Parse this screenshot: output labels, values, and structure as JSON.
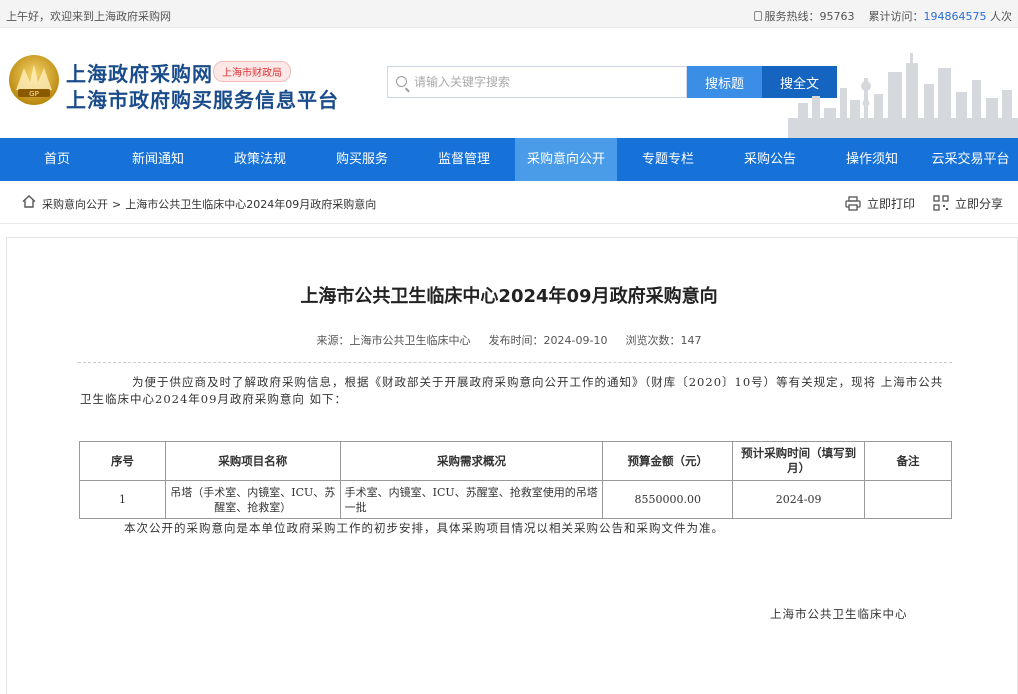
{
  "topbar": {
    "greeting": "上午好，欢迎来到上海政府采购网",
    "hotline_label": "服务热线：",
    "hotline": "95763",
    "visits_label": "累计访问：",
    "visits": "194864575",
    "visits_unit": "人次"
  },
  "header": {
    "site_name": "上海政府采购网",
    "tag": "上海市财政局",
    "subtitle": "上海市政府购买服务信息平台",
    "search_placeholder": "请输入关键字搜索",
    "btn_title": "搜标题",
    "btn_full": "搜全文"
  },
  "nav": [
    {
      "label": "首页"
    },
    {
      "label": "新闻通知"
    },
    {
      "label": "政策法规"
    },
    {
      "label": "购买服务"
    },
    {
      "label": "监督管理"
    },
    {
      "label": "采购意向公开"
    },
    {
      "label": "专题专栏"
    },
    {
      "label": "采购公告"
    },
    {
      "label": "操作须知"
    },
    {
      "label": "云采交易平台"
    }
  ],
  "breadcrumb": {
    "parent": "采购意向公开",
    "sep": ">",
    "current": "上海市公共卫生临床中心2024年09月政府采购意向"
  },
  "actions": {
    "print": "立即打印",
    "share": "立即分享"
  },
  "article": {
    "title": "上海市公共卫生临床中心2024年09月政府采购意向",
    "source": "来源：上海市公共卫生临床中心",
    "date": "发布时间：2024-09-10",
    "views": "浏览次数：147",
    "intro": "为便于供应商及时了解政府采购信息，根据《财政部关于开展政府采购意向公开工作的通知》（财库〔2020〕10号）等有关规定，现将 上海市公共卫生临床中心2024年09月政府采购意向 如下：",
    "note": "本次公开的采购意向是本单位政府采购工作的初步安排，具体采购项目情况以相关采购公告和采购文件为准。",
    "signature": "上海市公共卫生临床中心"
  },
  "table": {
    "headers": [
      "序号",
      "采购项目名称",
      "采购需求概况",
      "预算金额（元）",
      "预计采购时间（填写到月）",
      "备注"
    ],
    "rows": [
      [
        "1",
        "吊塔（手术室、内镜室、ICU、苏醒室、抢救室）",
        "手术室、内镜室、ICU、苏醒室、抢救室使用的吊塔一批",
        "8550000.00",
        "2024-09",
        ""
      ]
    ]
  }
}
